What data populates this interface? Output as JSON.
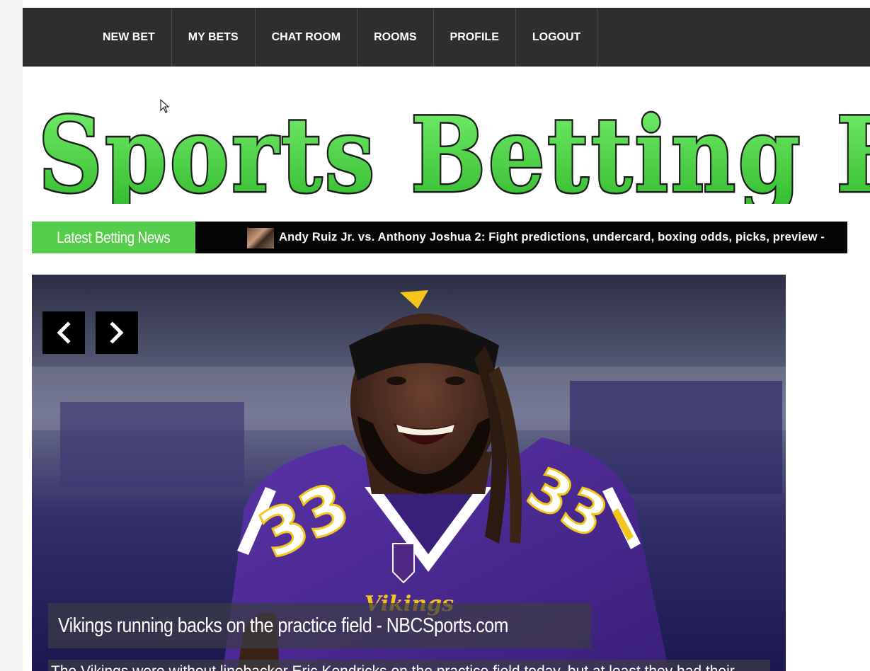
{
  "nav": {
    "items": [
      {
        "label": "NEW BET"
      },
      {
        "label": "MY BETS"
      },
      {
        "label": "CHAT ROOM"
      },
      {
        "label": "ROOMS"
      },
      {
        "label": "PROFILE"
      },
      {
        "label": "LOGOUT"
      }
    ]
  },
  "logo": {
    "text": "Sports Betting F",
    "fill_color": "#4fdc49",
    "outline_color": "#1d1d1d"
  },
  "ticker": {
    "label": "Latest Betting News",
    "headline": "Andy Ruiz Jr. vs. Anthony Joshua 2: Fight predictions, undercard, boxing odds, picks, preview -",
    "label_color": "#55cc4b"
  },
  "slider": {
    "caption_title": "Vikings running backs on the practice field - NBCSports.com",
    "caption_text": "The Vikings were without linebacker Eric Kendricks on the practice field today, but at least they had their",
    "prev_icon": "chevron-left-icon",
    "next_icon": "chevron-right-icon"
  },
  "colors": {
    "navbar": "#2e2e2c",
    "accent_green": "#55cc4b",
    "jersey_purple": "#4f2683"
  }
}
